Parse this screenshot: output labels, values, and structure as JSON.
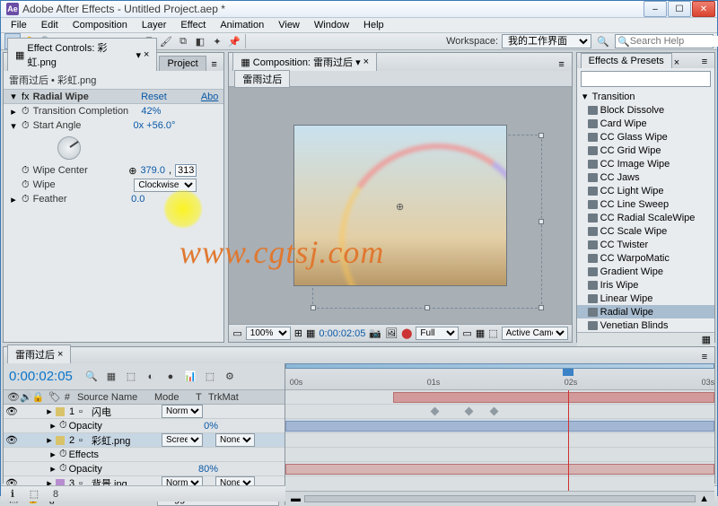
{
  "window": {
    "title": "Adobe After Effects - Untitled Project.aep *",
    "min": "–",
    "max": "☐",
    "close": "✕"
  },
  "menu": [
    "File",
    "Edit",
    "Composition",
    "Layer",
    "Effect",
    "Animation",
    "View",
    "Window",
    "Help"
  ],
  "workspace": {
    "label": "Workspace:",
    "value": "我的工作界面"
  },
  "search": {
    "placeholder": "Search Help",
    "icon": "🔍"
  },
  "ec": {
    "tab1": "Effect Controls: 彩虹.png",
    "tab2": "Project",
    "header": "雷雨过后 • 彩虹.png",
    "fx": "Radial Wipe",
    "reset": "Reset",
    "about": "Abo",
    "rows": {
      "completion": {
        "label": "Transition Completion",
        "value": "42%"
      },
      "angle": {
        "label": "Start Angle",
        "value": "0x +56.0°"
      },
      "center": {
        "label": "Wipe Center",
        "x": "379.0",
        "y": "313"
      },
      "wipe": {
        "label": "Wipe",
        "value": "Clockwise"
      },
      "feather": {
        "label": "Feather",
        "value": "0.0"
      }
    }
  },
  "comp": {
    "tab": "Composition: 雷雨过后",
    "subtab": "雷雨过后",
    "footer": {
      "zoom": "100%",
      "time": "0:00:02:05",
      "quality": "Full",
      "active": "Active Came"
    }
  },
  "ep": {
    "tab": "Effects & Presets",
    "category": "Transition",
    "items": [
      "Block Dissolve",
      "Card Wipe",
      "CC Glass Wipe",
      "CC Grid Wipe",
      "CC Image Wipe",
      "CC Jaws",
      "CC Light Wipe",
      "CC Line Sweep",
      "CC Radial ScaleWipe",
      "CC Scale Wipe",
      "CC Twister",
      "CC WarpoMatic",
      "Gradient Wipe",
      "Iris Wipe",
      "Linear Wipe",
      "Radial Wipe",
      "Venetian Blinds"
    ],
    "selected": "Radial Wipe"
  },
  "timeline": {
    "tab": "雷雨过后",
    "time": "0:00:02:05",
    "columns": {
      "num": "#",
      "source": "Source Name",
      "mode": "Mode",
      "trkmat": "TrkMat"
    },
    "layers": [
      {
        "num": "1",
        "name": "闪电",
        "mode": "Norma",
        "color": "#d9c36a"
      },
      {
        "num": "",
        "name": "Opacity",
        "mode": "0%",
        "sub": true
      },
      {
        "num": "2",
        "name": "彩虹.png",
        "mode": "Screen",
        "trkmat": "None",
        "color": "#d9c36a",
        "sel": true
      },
      {
        "num": "",
        "name": "Effects",
        "sub": true
      },
      {
        "num": "",
        "name": "Opacity",
        "mode": "80%",
        "sub": true
      },
      {
        "num": "3",
        "name": "背景.jpg",
        "mode": "Norma",
        "trkmat": "None",
        "color": "#b78dcf"
      }
    ],
    "ruler": [
      "00s",
      "01s",
      "02s",
      "03s"
    ],
    "toggle": "Toggle Switches / Modes"
  },
  "watermark": "www.cgtsj.com"
}
